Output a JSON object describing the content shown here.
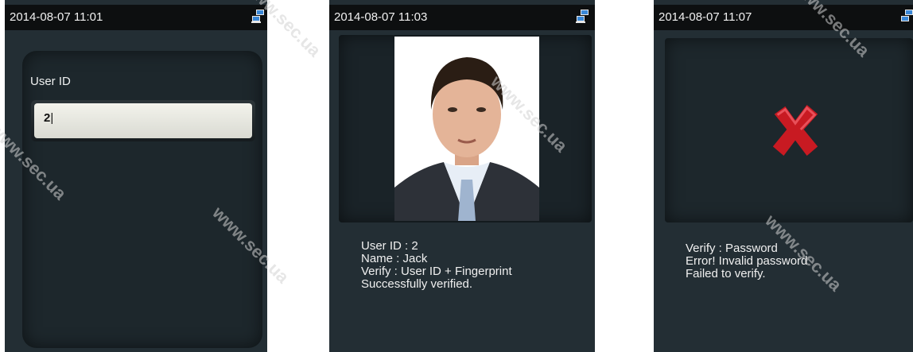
{
  "screens": [
    {
      "datetime": "2014-08-07 11:01",
      "field_label": "User ID",
      "field_value": "2"
    },
    {
      "datetime": "2014-08-07 11:03",
      "info_lines": [
        "User ID : 2",
        "Name : Jack",
        "Verify : User ID + Fingerprint",
        "Successfully verified."
      ]
    },
    {
      "datetime": "2014-08-07 11:07",
      "info_lines": [
        "Verify : Password",
        "Error! Invalid password",
        "Failed to verify."
      ]
    }
  ],
  "watermark": "www.sec.ua",
  "colors": {
    "screen_bg": "#232e34",
    "status_bar": "#0d0f10",
    "error_x": "#d0202a"
  },
  "icons": {
    "network": "network-computers-icon",
    "error": "red-x-icon"
  }
}
